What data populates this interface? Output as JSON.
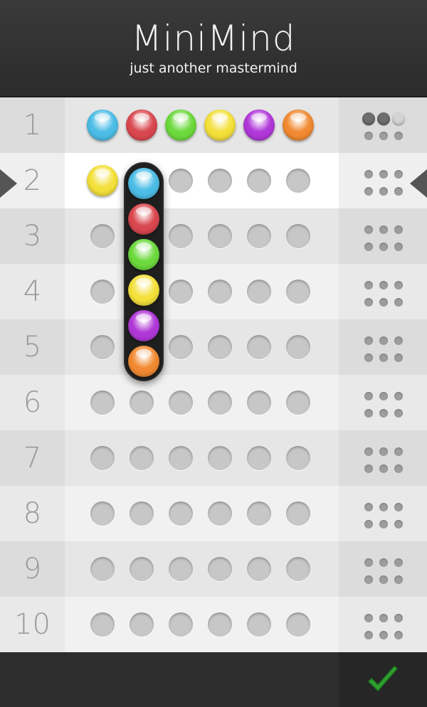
{
  "app": {
    "title": "MiniMind",
    "subtitle": "just another mastermind"
  },
  "colors": {
    "blue": "#4cbde6",
    "red": "#d9474f",
    "green": "#6cd93d",
    "yellow": "#f3e03a",
    "purple": "#b038d8",
    "orange": "#f18a32"
  },
  "active_row": 2,
  "rows": [
    {
      "number": "1",
      "pegs": [
        "blue",
        "red",
        "green",
        "yellow",
        "purple",
        "orange"
      ],
      "feedback": [
        "black",
        "black",
        "white",
        "empty",
        "empty",
        "empty"
      ]
    },
    {
      "number": "2",
      "pegs": [
        "yellow",
        "empty",
        "empty",
        "empty",
        "empty",
        "empty"
      ],
      "feedback": [
        "empty",
        "empty",
        "empty",
        "empty",
        "empty",
        "empty"
      ]
    },
    {
      "number": "3",
      "pegs": [
        "empty",
        "empty",
        "empty",
        "empty",
        "empty",
        "empty"
      ],
      "feedback": [
        "empty",
        "empty",
        "empty",
        "empty",
        "empty",
        "empty"
      ]
    },
    {
      "number": "4",
      "pegs": [
        "empty",
        "empty",
        "empty",
        "empty",
        "empty",
        "empty"
      ],
      "feedback": [
        "empty",
        "empty",
        "empty",
        "empty",
        "empty",
        "empty"
      ]
    },
    {
      "number": "5",
      "pegs": [
        "empty",
        "empty",
        "empty",
        "empty",
        "empty",
        "empty"
      ],
      "feedback": [
        "empty",
        "empty",
        "empty",
        "empty",
        "empty",
        "empty"
      ]
    },
    {
      "number": "6",
      "pegs": [
        "empty",
        "empty",
        "empty",
        "empty",
        "empty",
        "empty"
      ],
      "feedback": [
        "empty",
        "empty",
        "empty",
        "empty",
        "empty",
        "empty"
      ]
    },
    {
      "number": "7",
      "pegs": [
        "empty",
        "empty",
        "empty",
        "empty",
        "empty",
        "empty"
      ],
      "feedback": [
        "empty",
        "empty",
        "empty",
        "empty",
        "empty",
        "empty"
      ]
    },
    {
      "number": "8",
      "pegs": [
        "empty",
        "empty",
        "empty",
        "empty",
        "empty",
        "empty"
      ],
      "feedback": [
        "empty",
        "empty",
        "empty",
        "empty",
        "empty",
        "empty"
      ]
    },
    {
      "number": "9",
      "pegs": [
        "empty",
        "empty",
        "empty",
        "empty",
        "empty",
        "empty"
      ],
      "feedback": [
        "empty",
        "empty",
        "empty",
        "empty",
        "empty",
        "empty"
      ]
    },
    {
      "number": "10",
      "pegs": [
        "empty",
        "empty",
        "empty",
        "empty",
        "empty",
        "empty"
      ],
      "feedback": [
        "empty",
        "empty",
        "empty",
        "empty",
        "empty",
        "empty"
      ]
    }
  ],
  "picker": {
    "column": 2,
    "options": [
      "blue",
      "red",
      "green",
      "yellow",
      "purple",
      "orange"
    ]
  },
  "icons": {
    "active_row_indicator": "triangle-arrow-icon",
    "submit": "checkmark-icon",
    "submit_color": "#2fa12e"
  }
}
